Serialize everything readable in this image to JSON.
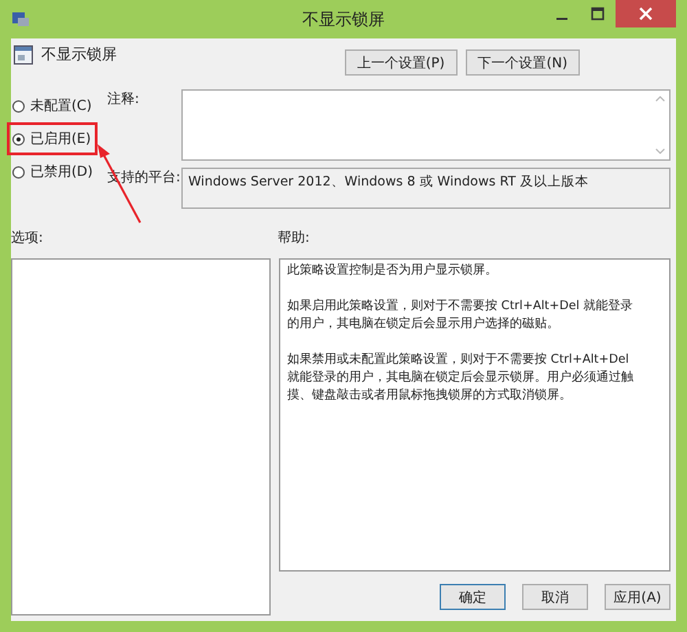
{
  "window": {
    "title": "不显示锁屏"
  },
  "policy_name": "不显示锁屏",
  "nav_buttons": [
    "上一个设置(P)",
    "下一个设置(N)"
  ],
  "options": [
    {
      "label": "未配置(C)",
      "selected": false,
      "highlighted": false
    },
    {
      "label": "已启用(E)",
      "selected": true,
      "highlighted": true
    },
    {
      "label": "已禁用(D)",
      "selected": false,
      "highlighted": false
    }
  ],
  "comment": {
    "label": "注释:"
  },
  "platform": {
    "label": "支持的平台:",
    "value": "Windows Server 2012、Windows 8 或 Windows RT 及以上版本"
  },
  "options_label": "选项:",
  "help": {
    "label": "帮助:",
    "paragraphs": [
      "此策略设置控制是否为用户显示锁屏。",
      "如果启用此策略设置，则对于不需要按 Ctrl+Alt+Del 就能登录的用户，其电脑在锁定后会显示用户选择的磁贴。",
      "如果禁用或未配置此策略设置，则对于不需要按 Ctrl+Alt+Del 就能登录的用户，其电脑在锁定后会显示锁屏。用户必须通过触摸、键盘敲击或者用鼠标拖拽锁屏的方式取消锁屏。"
    ]
  },
  "buttons": [
    {
      "label": "确定",
      "kind": "default"
    },
    {
      "label": "取消",
      "kind": "normal"
    },
    {
      "label": "应用(A)",
      "kind": "normal"
    }
  ]
}
